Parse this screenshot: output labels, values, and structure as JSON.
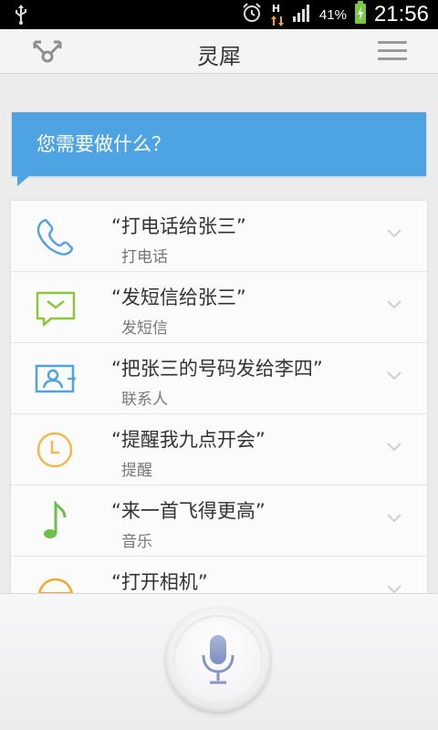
{
  "status_bar": {
    "battery_percent": "41%",
    "time": "21:56",
    "network_label": "H",
    "icons": [
      "usb-icon",
      "alarm-icon",
      "data-arrows-icon",
      "signal-icon",
      "battery-charging-icon"
    ]
  },
  "header": {
    "title": "灵犀",
    "left_icon": "share-icon",
    "right_icon": "menu-icon"
  },
  "prompt": {
    "text": "您需要做什么？"
  },
  "commands": [
    {
      "example": "“打电话给张三”",
      "category": "打电话",
      "icon": "phone-icon",
      "color": "#5aa2dd"
    },
    {
      "example": "“发短信给张三”",
      "category": "发短信",
      "icon": "message-icon",
      "color": "#8cc63f"
    },
    {
      "example": "“把张三的号码发给李四”",
      "category": "联系人",
      "icon": "contact-card-icon",
      "color": "#4ea4e2"
    },
    {
      "example": "“提醒我九点开会”",
      "category": "提醒",
      "icon": "clock-icon",
      "color": "#f2b84b"
    },
    {
      "example": "“来一首飞得更高”",
      "category": "音乐",
      "icon": "music-note-icon",
      "color": "#6cbf4a"
    },
    {
      "example": "“打开相机”",
      "category": "",
      "icon": "app-icon",
      "color": "#f0a830"
    }
  ],
  "voice": {
    "icon": "microphone-icon"
  }
}
